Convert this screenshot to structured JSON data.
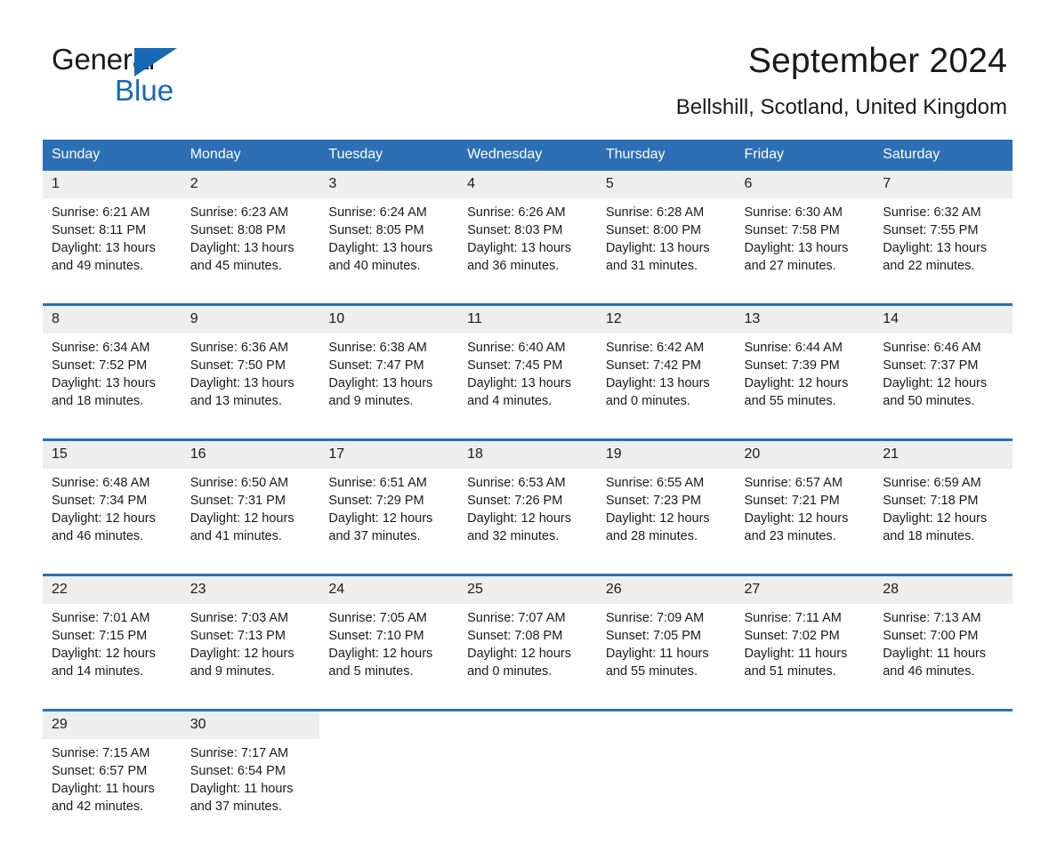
{
  "brand": {
    "name_part1": "General",
    "name_part2": "Blue",
    "triangle_color": "#1569b4",
    "logo_icon": "triangle-logo-icon"
  },
  "header": {
    "title": "September 2024",
    "subtitle": "Bellshill, Scotland, United Kingdom"
  },
  "theme": {
    "header_bg": "#2c6fb5",
    "day_number_bg": "#eeeeee",
    "page_bg": "#ffffff",
    "text": "#1a1a1a"
  },
  "calendar": {
    "weekday_headers": [
      "Sunday",
      "Monday",
      "Tuesday",
      "Wednesday",
      "Thursday",
      "Friday",
      "Saturday"
    ],
    "weeks": [
      [
        {
          "day": "1",
          "sunrise": "Sunrise: 6:21 AM",
          "sunset": "Sunset: 8:11 PM",
          "daylight1": "Daylight: 13 hours",
          "daylight2": "and 49 minutes."
        },
        {
          "day": "2",
          "sunrise": "Sunrise: 6:23 AM",
          "sunset": "Sunset: 8:08 PM",
          "daylight1": "Daylight: 13 hours",
          "daylight2": "and 45 minutes."
        },
        {
          "day": "3",
          "sunrise": "Sunrise: 6:24 AM",
          "sunset": "Sunset: 8:05 PM",
          "daylight1": "Daylight: 13 hours",
          "daylight2": "and 40 minutes."
        },
        {
          "day": "4",
          "sunrise": "Sunrise: 6:26 AM",
          "sunset": "Sunset: 8:03 PM",
          "daylight1": "Daylight: 13 hours",
          "daylight2": "and 36 minutes."
        },
        {
          "day": "5",
          "sunrise": "Sunrise: 6:28 AM",
          "sunset": "Sunset: 8:00 PM",
          "daylight1": "Daylight: 13 hours",
          "daylight2": "and 31 minutes."
        },
        {
          "day": "6",
          "sunrise": "Sunrise: 6:30 AM",
          "sunset": "Sunset: 7:58 PM",
          "daylight1": "Daylight: 13 hours",
          "daylight2": "and 27 minutes."
        },
        {
          "day": "7",
          "sunrise": "Sunrise: 6:32 AM",
          "sunset": "Sunset: 7:55 PM",
          "daylight1": "Daylight: 13 hours",
          "daylight2": "and 22 minutes."
        }
      ],
      [
        {
          "day": "8",
          "sunrise": "Sunrise: 6:34 AM",
          "sunset": "Sunset: 7:52 PM",
          "daylight1": "Daylight: 13 hours",
          "daylight2": "and 18 minutes."
        },
        {
          "day": "9",
          "sunrise": "Sunrise: 6:36 AM",
          "sunset": "Sunset: 7:50 PM",
          "daylight1": "Daylight: 13 hours",
          "daylight2": "and 13 minutes."
        },
        {
          "day": "10",
          "sunrise": "Sunrise: 6:38 AM",
          "sunset": "Sunset: 7:47 PM",
          "daylight1": "Daylight: 13 hours",
          "daylight2": "and 9 minutes."
        },
        {
          "day": "11",
          "sunrise": "Sunrise: 6:40 AM",
          "sunset": "Sunset: 7:45 PM",
          "daylight1": "Daylight: 13 hours",
          "daylight2": "and 4 minutes."
        },
        {
          "day": "12",
          "sunrise": "Sunrise: 6:42 AM",
          "sunset": "Sunset: 7:42 PM",
          "daylight1": "Daylight: 13 hours",
          "daylight2": "and 0 minutes."
        },
        {
          "day": "13",
          "sunrise": "Sunrise: 6:44 AM",
          "sunset": "Sunset: 7:39 PM",
          "daylight1": "Daylight: 12 hours",
          "daylight2": "and 55 minutes."
        },
        {
          "day": "14",
          "sunrise": "Sunrise: 6:46 AM",
          "sunset": "Sunset: 7:37 PM",
          "daylight1": "Daylight: 12 hours",
          "daylight2": "and 50 minutes."
        }
      ],
      [
        {
          "day": "15",
          "sunrise": "Sunrise: 6:48 AM",
          "sunset": "Sunset: 7:34 PM",
          "daylight1": "Daylight: 12 hours",
          "daylight2": "and 46 minutes."
        },
        {
          "day": "16",
          "sunrise": "Sunrise: 6:50 AM",
          "sunset": "Sunset: 7:31 PM",
          "daylight1": "Daylight: 12 hours",
          "daylight2": "and 41 minutes."
        },
        {
          "day": "17",
          "sunrise": "Sunrise: 6:51 AM",
          "sunset": "Sunset: 7:29 PM",
          "daylight1": "Daylight: 12 hours",
          "daylight2": "and 37 minutes."
        },
        {
          "day": "18",
          "sunrise": "Sunrise: 6:53 AM",
          "sunset": "Sunset: 7:26 PM",
          "daylight1": "Daylight: 12 hours",
          "daylight2": "and 32 minutes."
        },
        {
          "day": "19",
          "sunrise": "Sunrise: 6:55 AM",
          "sunset": "Sunset: 7:23 PM",
          "daylight1": "Daylight: 12 hours",
          "daylight2": "and 28 minutes."
        },
        {
          "day": "20",
          "sunrise": "Sunrise: 6:57 AM",
          "sunset": "Sunset: 7:21 PM",
          "daylight1": "Daylight: 12 hours",
          "daylight2": "and 23 minutes."
        },
        {
          "day": "21",
          "sunrise": "Sunrise: 6:59 AM",
          "sunset": "Sunset: 7:18 PM",
          "daylight1": "Daylight: 12 hours",
          "daylight2": "and 18 minutes."
        }
      ],
      [
        {
          "day": "22",
          "sunrise": "Sunrise: 7:01 AM",
          "sunset": "Sunset: 7:15 PM",
          "daylight1": "Daylight: 12 hours",
          "daylight2": "and 14 minutes."
        },
        {
          "day": "23",
          "sunrise": "Sunrise: 7:03 AM",
          "sunset": "Sunset: 7:13 PM",
          "daylight1": "Daylight: 12 hours",
          "daylight2": "and 9 minutes."
        },
        {
          "day": "24",
          "sunrise": "Sunrise: 7:05 AM",
          "sunset": "Sunset: 7:10 PM",
          "daylight1": "Daylight: 12 hours",
          "daylight2": "and 5 minutes."
        },
        {
          "day": "25",
          "sunrise": "Sunrise: 7:07 AM",
          "sunset": "Sunset: 7:08 PM",
          "daylight1": "Daylight: 12 hours",
          "daylight2": "and 0 minutes."
        },
        {
          "day": "26",
          "sunrise": "Sunrise: 7:09 AM",
          "sunset": "Sunset: 7:05 PM",
          "daylight1": "Daylight: 11 hours",
          "daylight2": "and 55 minutes."
        },
        {
          "day": "27",
          "sunrise": "Sunrise: 7:11 AM",
          "sunset": "Sunset: 7:02 PM",
          "daylight1": "Daylight: 11 hours",
          "daylight2": "and 51 minutes."
        },
        {
          "day": "28",
          "sunrise": "Sunrise: 7:13 AM",
          "sunset": "Sunset: 7:00 PM",
          "daylight1": "Daylight: 11 hours",
          "daylight2": "and 46 minutes."
        }
      ],
      [
        {
          "day": "29",
          "sunrise": "Sunrise: 7:15 AM",
          "sunset": "Sunset: 6:57 PM",
          "daylight1": "Daylight: 11 hours",
          "daylight2": "and 42 minutes."
        },
        {
          "day": "30",
          "sunrise": "Sunrise: 7:17 AM",
          "sunset": "Sunset: 6:54 PM",
          "daylight1": "Daylight: 11 hours",
          "daylight2": "and 37 minutes."
        },
        {
          "day": "",
          "sunrise": "",
          "sunset": "",
          "daylight1": "",
          "daylight2": ""
        },
        {
          "day": "",
          "sunrise": "",
          "sunset": "",
          "daylight1": "",
          "daylight2": ""
        },
        {
          "day": "",
          "sunrise": "",
          "sunset": "",
          "daylight1": "",
          "daylight2": ""
        },
        {
          "day": "",
          "sunrise": "",
          "sunset": "",
          "daylight1": "",
          "daylight2": ""
        },
        {
          "day": "",
          "sunrise": "",
          "sunset": "",
          "daylight1": "",
          "daylight2": ""
        }
      ]
    ]
  }
}
